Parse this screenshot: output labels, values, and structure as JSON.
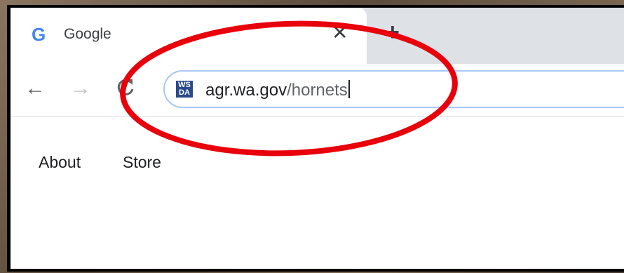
{
  "browser": {
    "tab": {
      "title": "Google",
      "favicon": "google-g-icon",
      "close_glyph": "✕"
    },
    "new_tab_glyph": "+",
    "toolbar": {
      "back_glyph": "←",
      "forward_glyph": "→",
      "reload_glyph": "C"
    },
    "omnibox": {
      "favicon_top": "WS",
      "favicon_bottom": "DA",
      "host": "agr.wa.gov",
      "path": "/hornets"
    }
  },
  "page": {
    "links": [
      "About",
      "Store"
    ]
  },
  "colors": {
    "annotation_circle": "#e8000b",
    "omnibox_border": "#a8c7fa",
    "tabstrip_bg": "#dee1e6"
  }
}
